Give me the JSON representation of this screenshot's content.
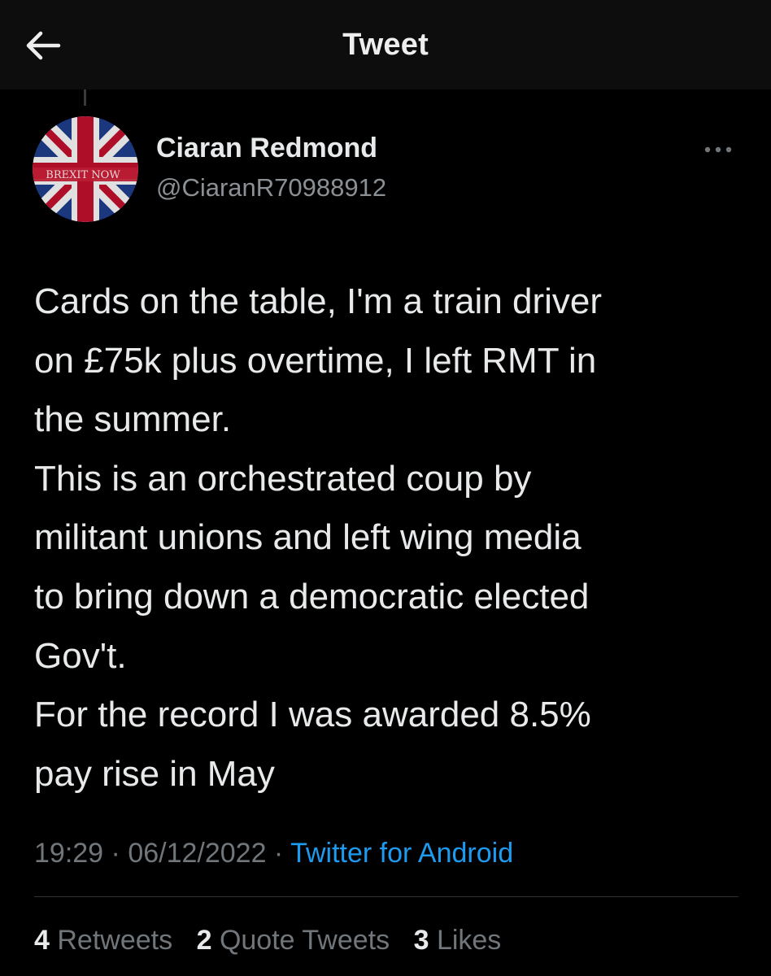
{
  "header": {
    "title": "Tweet",
    "back_icon": "arrow-left-icon"
  },
  "author": {
    "display_name": "Ciaran Redmond",
    "handle": "@CiaranR70988912",
    "avatar_banner_text": "BREXIT NOW"
  },
  "tweet": {
    "lines": [
      "Cards on the table, I'm a train driver",
      "on £75k plus overtime, I left RMT in",
      "the summer.",
      "This is an orchestrated coup by",
      "militant unions and left wing media",
      "to bring down a democratic elected",
      "Gov't.",
      "For the record I was awarded 8.5%",
      "pay rise in May"
    ],
    "time": "19:29",
    "date": "06/12/2022",
    "separator": " · ",
    "source": "Twitter for Android"
  },
  "stats": {
    "retweets_count": "4",
    "retweets_label": "Retweets",
    "quotes_count": "2",
    "quotes_label": "Quote Tweets",
    "likes_count": "3",
    "likes_label": "Likes"
  },
  "colors": {
    "background": "#000000",
    "header_bg": "#0d0d0d",
    "text": "#e7e9ea",
    "muted": "#71767b",
    "link": "#1d9bf0"
  }
}
